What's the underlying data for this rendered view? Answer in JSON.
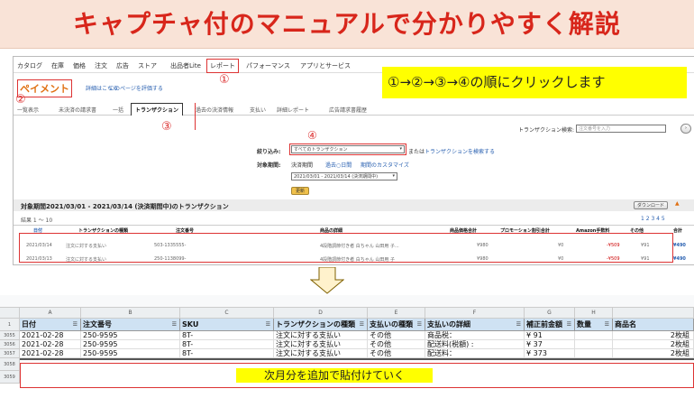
{
  "banner": {
    "title": "キャプチャ付のマニュアルで分かりやすく解説"
  },
  "nav": {
    "items": [
      "カタログ",
      "在庫",
      "価格",
      "注文",
      "広告",
      "ストア",
      "出品者Lite",
      "レポート",
      "パフォーマンス",
      "アプリとサービス"
    ]
  },
  "markers": {
    "m1": "①",
    "m2": "②",
    "m3": "③",
    "m4": "④"
  },
  "instruction": "①→②→③→④の順にクリックします",
  "payment": {
    "title": "ペイメント",
    "link1": "詳細はこちら",
    "link2": "このページを評価する"
  },
  "tabs": [
    "一覧表示",
    "未決済の請求書",
    "一括",
    "トランザクション",
    "過去の決済情報",
    "支払い",
    "詳細レポート",
    "広告請求書履歴"
  ],
  "search": {
    "label": "トランザクション検索:",
    "placeholder": "注文番号を入力"
  },
  "filter": {
    "label": "絞り込み:",
    "select": "すべてのトランザクション",
    "or": "または",
    "link": "トランザクションを検索する"
  },
  "period": {
    "label": "対象期間:",
    "opt1": "決済期間",
    "opt2": "過去○日間",
    "opt3": "期間のカスタマイズ",
    "range": "2021/03/01 - 2021/03/14 (決済期間中)",
    "update": "更新"
  },
  "section": {
    "title": "対象期間2021/03/01 - 2021/03/14 (決済期間中)のトランザクション",
    "download": "ダウンロード",
    "count": "結果 1 ～ 10",
    "pages": "1 2 3 4 5"
  },
  "table1": {
    "headers": [
      "日付",
      "トランザクションの種類",
      "注文番号",
      "商品の詳細",
      "商品価格合計",
      "プロモーション割引合計",
      "Amazon手数料",
      "その他",
      "合計"
    ],
    "rows": [
      [
        "2021/03/14",
        "注文に対する支払い",
        "503-1335555-",
        "4段階調節付き者 白ちゃん 山田用 子...",
        "¥980",
        "¥0",
        "-¥509",
        "¥91",
        "¥490"
      ],
      [
        "2021/03/13",
        "注文に対する支払い",
        "250-1138099-",
        "4段階調節付き者 白ちゃん 山田用 子",
        "¥980",
        "¥0",
        "-¥509",
        "¥91",
        "¥490"
      ]
    ]
  },
  "sheet": {
    "cols": [
      "",
      "A",
      "B",
      "C",
      "D",
      "E",
      "F",
      "G",
      "H",
      ""
    ],
    "headers": [
      "日付",
      "注文番号",
      "SKU",
      "トランザクションの種類",
      "支払いの種類",
      "支払いの詳細",
      "補正前金額",
      "数量",
      "商品名"
    ],
    "rownums": [
      "1",
      "3055",
      "3056",
      "3057",
      "3058",
      "3059"
    ],
    "rows": [
      [
        "2021-02-28",
        "250-9595",
        "8T-",
        "注文に対する支払い",
        "その他",
        "商品税：",
        "¥ 91",
        "",
        "2枚組"
      ],
      [
        "2021-02-28",
        "250-9595",
        "8T-",
        "注文に対する支払い",
        "その他",
        "配送料(税額) :",
        "¥ 37",
        "",
        "2枚組"
      ],
      [
        "2021-02-28",
        "250-9595",
        "8T-",
        "注文に対する支払い",
        "その他",
        "配送料：",
        "¥ 373",
        "",
        "2枚組"
      ]
    ]
  },
  "note": "次月分を追加で貼付けていく",
  "colors": {
    "banner_text": "#d8261b",
    "banner_bg": "#f9e3d7",
    "marker": "#dd3333",
    "highlight": "#ffff00",
    "header_fill": "#cfe2f3"
  }
}
